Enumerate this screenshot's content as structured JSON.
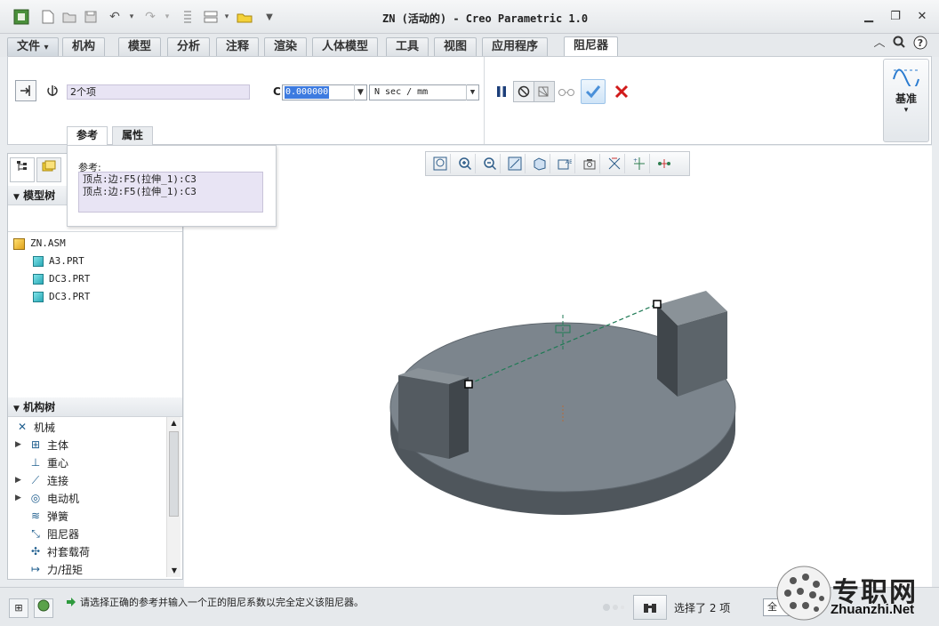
{
  "window": {
    "title": "ZN (活动的) - Creo Parametric 1.0"
  },
  "ribbon_tabs": [
    {
      "label": "文件",
      "dropdown": "▾"
    },
    {
      "label": "机构"
    },
    {
      "label": "模型"
    },
    {
      "label": "分析"
    },
    {
      "label": "注释"
    },
    {
      "label": "渲染"
    },
    {
      "label": "人体模型"
    },
    {
      "label": "工具"
    },
    {
      "label": "视图"
    },
    {
      "label": "应用程序"
    },
    {
      "label": "阻尼器",
      "active": true
    }
  ],
  "damper": {
    "references_summary": "2个项",
    "coefficient_label": "C",
    "coefficient_value": "0.000000",
    "units": "N sec / mm",
    "datum_button": "基准"
  },
  "panel_tabs": {
    "references": "参考",
    "properties": "属性"
  },
  "references_panel": {
    "label": "参考:",
    "items": [
      "顶点:边:F5(拉伸_1):C3",
      "顶点:边:F5(拉伸_1):C3"
    ]
  },
  "model_tree": {
    "header": "模型树",
    "items": [
      {
        "name": "ZN.ASM",
        "type": "assembly"
      },
      {
        "name": "A3.PRT",
        "type": "part"
      },
      {
        "name": "DC3.PRT",
        "type": "part"
      },
      {
        "name": "DC3.PRT",
        "type": "part"
      }
    ]
  },
  "mechanism_tree": {
    "header": "机构树",
    "items": [
      {
        "label": "机械",
        "icon": "mechanism-icon",
        "expandable": false,
        "level": 0
      },
      {
        "label": "主体",
        "icon": "body-icon",
        "expandable": true,
        "level": 1
      },
      {
        "label": "重心",
        "icon": "gravity-icon",
        "expandable": false,
        "level": 1
      },
      {
        "label": "连接",
        "icon": "connection-icon",
        "expandable": true,
        "level": 1
      },
      {
        "label": "电动机",
        "icon": "motor-icon",
        "expandable": true,
        "level": 1
      },
      {
        "label": "弹簧",
        "icon": "spring-icon",
        "expandable": false,
        "level": 1
      },
      {
        "label": "阻尼器",
        "icon": "damper-icon",
        "expandable": false,
        "level": 1
      },
      {
        "label": "衬套载荷",
        "icon": "bushing-icon",
        "expandable": false,
        "level": 1
      },
      {
        "label": "力/扭矩",
        "icon": "force-torque-icon",
        "expandable": false,
        "level": 1
      }
    ]
  },
  "statusbar": {
    "message": "请选择正确的参考并输入一个正的阻尼系数以完全定义该阻尼器。",
    "selection": "选择了 2 项",
    "filter": "全"
  },
  "watermark": {
    "cn": "专职网",
    "en": "Zhuanzhi.Net"
  },
  "colors": {
    "accent": "#3d7be0",
    "confirm": "#4a90d9",
    "cancel": "#d11a1a",
    "model_gray": "#6f7880",
    "selection_purple": "#e8e4f4"
  }
}
